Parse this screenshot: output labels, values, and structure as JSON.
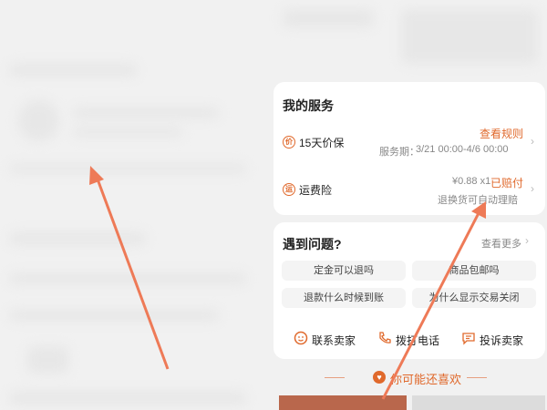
{
  "services": {
    "title": "我的服务",
    "price_protect": {
      "icon": "price-protect-icon",
      "label": "15天价保",
      "link": "查看规则",
      "period_label": "服务期：",
      "period_value": "3/21 00:00-4/6 00:00"
    },
    "shipping_insurance": {
      "icon": "shipping-insurance-icon",
      "label": "运费险",
      "price": "¥0.88 x1",
      "status": "已赔付",
      "note": "退换货可自动理赔"
    }
  },
  "help": {
    "title": "遇到问题?",
    "more": "查看更多",
    "questions": [
      "定金可以退吗",
      "商品包邮吗",
      "退款什么时候到账",
      "为什么显示交易关闭"
    ],
    "actions": [
      "联系卖家",
      "拨打电话",
      "投诉卖家"
    ]
  },
  "recommend": {
    "title": "你可能还喜欢"
  },
  "colors": {
    "accent": "#e0692c",
    "arrow": "#ee7a57"
  }
}
